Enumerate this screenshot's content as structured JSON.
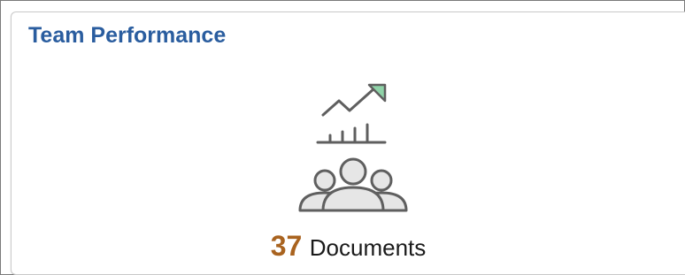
{
  "tile": {
    "title": "Team Performance",
    "count": "37",
    "count_label": "Documents",
    "icon_name": "team-performance-icon",
    "colors": {
      "title": "#2a5d9f",
      "count": "#a9631f",
      "icon_stroke": "#5f5f5f",
      "icon_fill": "#e6e6e6",
      "arrow_fill": "#8fd3a8"
    }
  }
}
